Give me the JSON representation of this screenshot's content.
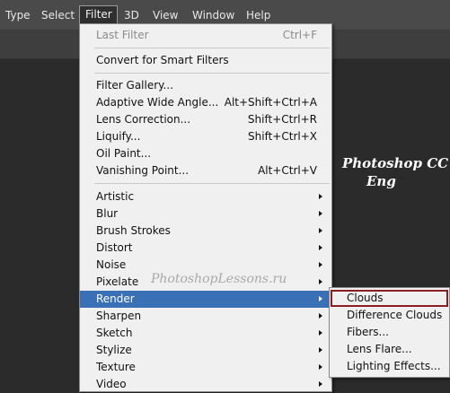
{
  "menubar": {
    "items": [
      "Type",
      "Select",
      "Filter",
      "3D",
      "View",
      "Window",
      "Help"
    ]
  },
  "filter_menu": {
    "items": [
      {
        "label": "Last Filter",
        "shortcut": "Ctrl+F"
      },
      {
        "label": "Convert for Smart Filters",
        "shortcut": ""
      },
      {
        "label": "Filter Gallery...",
        "shortcut": ""
      },
      {
        "label": "Adaptive Wide Angle...",
        "shortcut": "Alt+Shift+Ctrl+A"
      },
      {
        "label": "Lens Correction...",
        "shortcut": "Shift+Ctrl+R"
      },
      {
        "label": "Liquify...",
        "shortcut": "Shift+Ctrl+X"
      },
      {
        "label": "Oil Paint...",
        "shortcut": ""
      },
      {
        "label": "Vanishing Point...",
        "shortcut": "Alt+Ctrl+V"
      },
      {
        "label": "Artistic",
        "shortcut": ""
      },
      {
        "label": "Blur",
        "shortcut": ""
      },
      {
        "label": "Brush Strokes",
        "shortcut": ""
      },
      {
        "label": "Distort",
        "shortcut": ""
      },
      {
        "label": "Noise",
        "shortcut": ""
      },
      {
        "label": "Pixelate",
        "shortcut": ""
      },
      {
        "label": "Render",
        "shortcut": ""
      },
      {
        "label": "Sharpen",
        "shortcut": ""
      },
      {
        "label": "Sketch",
        "shortcut": ""
      },
      {
        "label": "Stylize",
        "shortcut": ""
      },
      {
        "label": "Texture",
        "shortcut": ""
      },
      {
        "label": "Video",
        "shortcut": ""
      }
    ]
  },
  "render_submenu": {
    "items": [
      "Clouds",
      "Difference Clouds",
      "Fibers...",
      "Lens Flare...",
      "Lighting Effects..."
    ]
  },
  "caption": {
    "line1": "Photoshop CC",
    "line2": "Eng"
  },
  "watermark": "PhotoshopLessons.ru",
  "colors": {
    "menubar_bg": "#4a4a4a",
    "canvas_bg": "#2b2b2b",
    "menu_bg": "#f0f0f0",
    "highlight": "#3a70b6",
    "selected_border": "#8a1e22"
  }
}
